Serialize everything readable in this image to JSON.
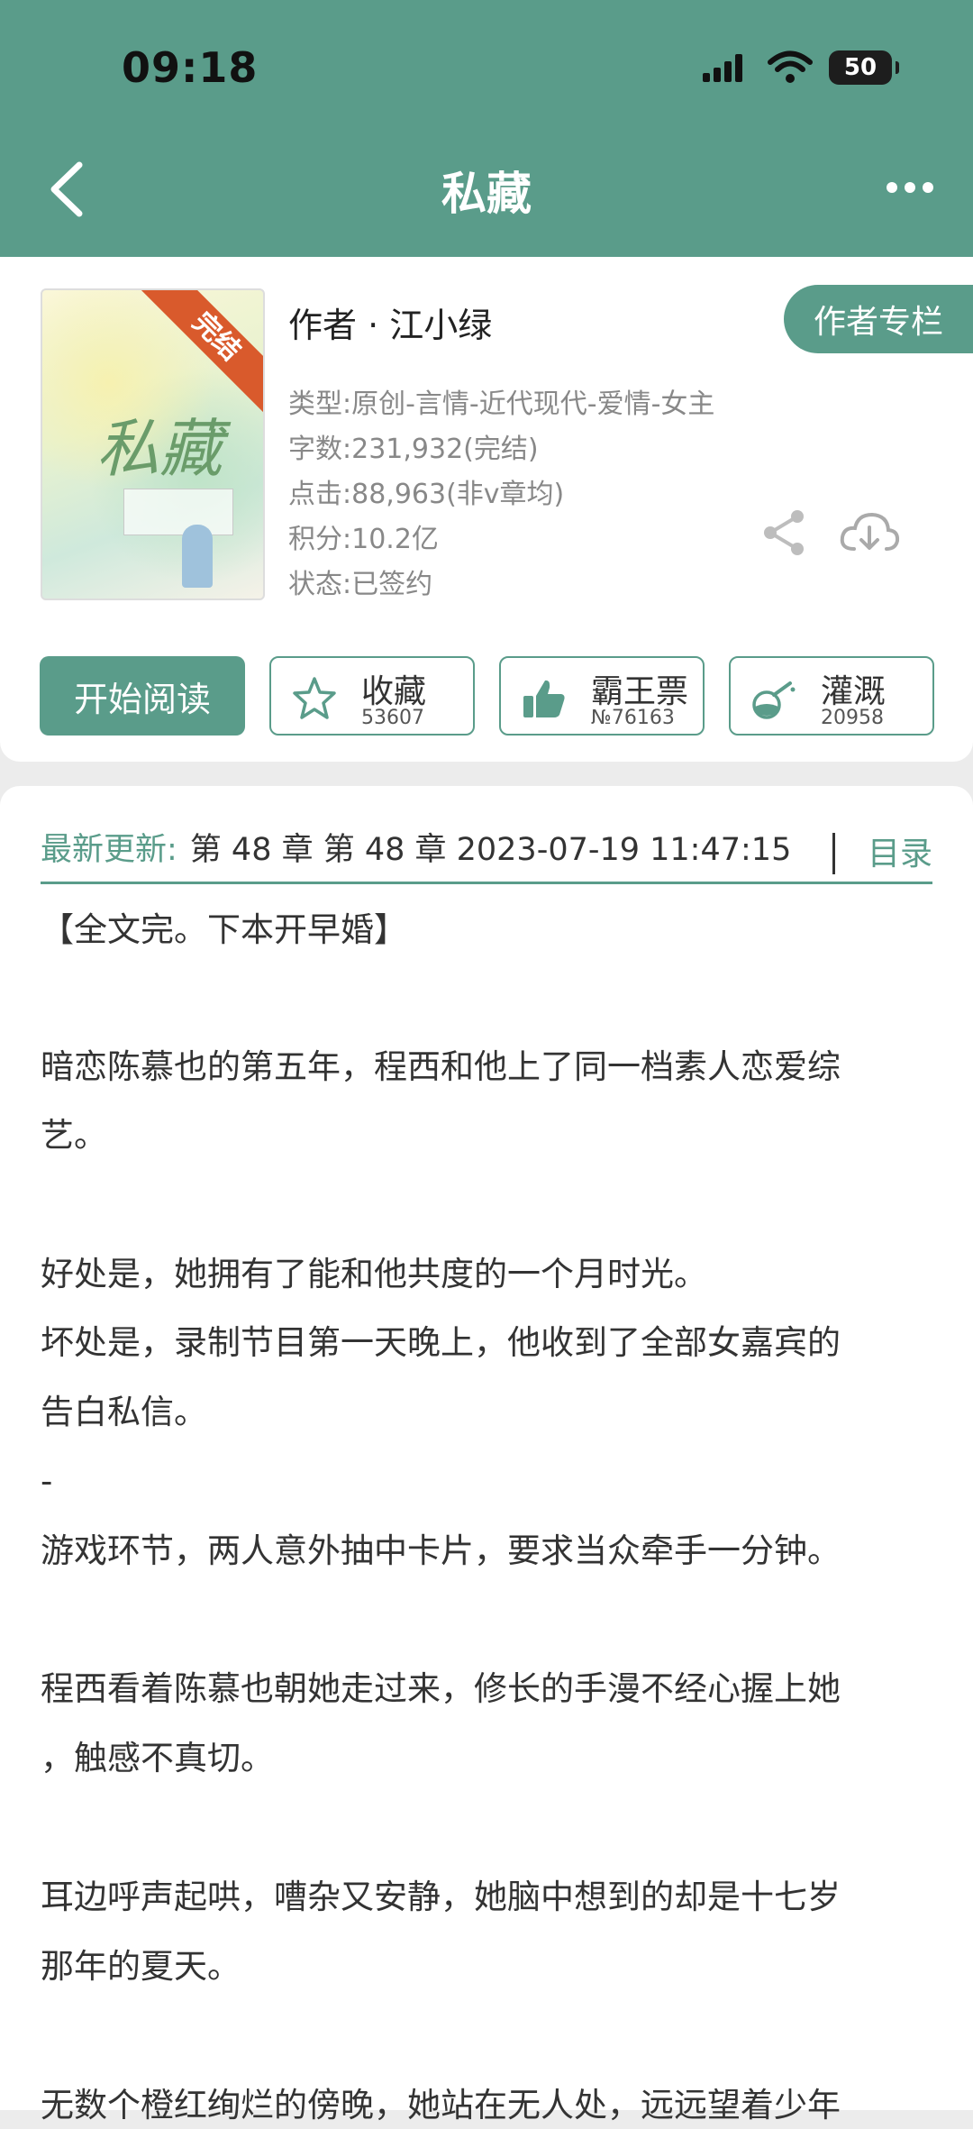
{
  "status_bar": {
    "time": "09:18",
    "battery": "50"
  },
  "header": {
    "title": "私藏"
  },
  "book": {
    "cover": {
      "title": "私藏",
      "badge": "完结"
    },
    "author": "作者 · 江小绿",
    "author_column_label": "作者专栏",
    "meta": [
      "类型:原创-言情-近代现代-爱情-女主",
      "字数:231,932(完结)",
      "点击:88,963(非v章均)",
      "积分:10.2亿",
      "状态:已签约"
    ]
  },
  "actions": {
    "read_label": "开始阅读",
    "buttons": [
      {
        "label": "收藏",
        "count": "53607",
        "icon": "star-icon"
      },
      {
        "label": "霸王票",
        "count": "№76163",
        "icon": "thumbs-up-icon"
      },
      {
        "label": "灌溉",
        "count": "20958",
        "icon": "watering-bottle-icon"
      }
    ]
  },
  "update": {
    "label": "最新更新:",
    "text": "第 48 章 第 48 章 2023-07-19 11:47:15",
    "toc_label": "目录"
  },
  "description": [
    "【全文完。下本开早婚】",
    "暗恋陈慕也的第五年，程西和他上了同一档素人恋爱综",
    "艺。",
    "好处是，她拥有了能和他共度的一个月时光。",
    "坏处是，录制节目第一天晚上，他收到了全部女嘉宾的",
    "告白私信。",
    "-",
    "游戏环节，两人意外抽中卡片，要求当众牵手一分钟。",
    "程西看着陈慕也朝她走过来，修长的手漫不经心握上她",
    "，触感不真切。",
    "耳边呼声起哄，嘈杂又安静，她脑中想到的却是十七岁",
    "那年的夏天。",
    "无数个橙红绚烂的傍晚，她站在无人处，远远望着少年"
  ],
  "colors": {
    "accent": "#5a9c8a",
    "badge": "#d95a2c"
  }
}
